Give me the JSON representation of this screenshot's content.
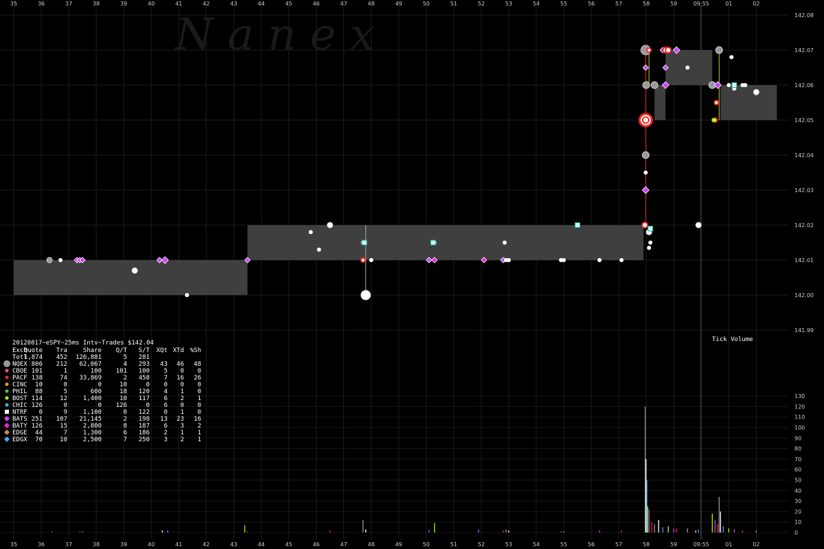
{
  "chart_data": [
    {
      "type": "scatter",
      "subtype": "price-trades",
      "watermark": "Nanex",
      "x_ticks": [
        "35",
        "36",
        "37",
        "38",
        "39",
        "40",
        "41",
        "42",
        "43",
        "44",
        "45",
        "46",
        "47",
        "48",
        "49",
        "50",
        "51",
        "52",
        "53",
        "54",
        "55",
        "56",
        "57",
        "58",
        "59",
        "09:55",
        "01",
        "02"
      ],
      "y_ticks": [
        "142.08",
        "142.07",
        "142.06",
        "142.05",
        "142.04",
        "142.03",
        "142.02",
        "142.01",
        "142.00",
        "141.99"
      ],
      "ylim": [
        141.99,
        142.08
      ],
      "xlim": [
        34.5,
        62.5
      ],
      "grid": true,
      "nbbo_bands": [
        {
          "x0": 35.0,
          "x1": 43.5,
          "bid": 142.0,
          "ask": 142.01
        },
        {
          "x0": 43.5,
          "x1": 57.9,
          "bid": 142.01,
          "ask": 142.02
        },
        {
          "x0": 58.3,
          "x1": 58.7,
          "bid": 142.05,
          "ask": 142.06
        },
        {
          "x0": 58.7,
          "x1": 60.4,
          "bid": 142.06,
          "ask": 142.07
        },
        {
          "x0": 60.7,
          "x1": 62.75,
          "bid": 142.05,
          "ask": 142.06
        }
      ],
      "trades": [
        {
          "x": 36.3,
          "y": 142.01,
          "exch": "NQEX",
          "size": 1
        },
        {
          "x": 36.7,
          "y": 142.01,
          "exch": "NTRF",
          "size": 1
        },
        {
          "x": 37.3,
          "y": 142.01,
          "exch": "BATS",
          "size": 1
        },
        {
          "x": 37.4,
          "y": 142.01,
          "exch": "BATS",
          "size": 1
        },
        {
          "x": 37.5,
          "y": 142.01,
          "exch": "BATS",
          "size": 1
        },
        {
          "x": 39.4,
          "y": 142.007,
          "exch": "NTRF",
          "size": 2
        },
        {
          "x": 40.3,
          "y": 142.01,
          "exch": "BATS",
          "size": 1
        },
        {
          "x": 40.5,
          "y": 142.01,
          "exch": "BATS",
          "size": 2
        },
        {
          "x": 41.3,
          "y": 142.0,
          "exch": "NTRF",
          "size": 1
        },
        {
          "x": 43.5,
          "y": 142.01,
          "exch": "BATS",
          "size": 1
        },
        {
          "x": 45.8,
          "y": 142.018,
          "exch": "NTRF",
          "size": 1
        },
        {
          "x": 46.1,
          "y": 142.013,
          "exch": "NTRF",
          "size": 1
        },
        {
          "x": 46.5,
          "y": 142.02,
          "exch": "NTRF",
          "size": 2
        },
        {
          "x": 47.7,
          "y": 142.015,
          "exch": "NTRF",
          "size": 1
        },
        {
          "x": 47.8,
          "y": 142.0,
          "exch": "NQEX",
          "size": 3
        },
        {
          "x": 47.7,
          "y": 142.01,
          "exch": "PACF",
          "size": 1
        },
        {
          "x": 48.0,
          "y": 142.01,
          "exch": "NTRF",
          "size": 1
        },
        {
          "x": 50.1,
          "y": 142.01,
          "exch": "BATS",
          "size": 1
        },
        {
          "x": 50.3,
          "y": 142.01,
          "exch": "BATY",
          "size": 1
        },
        {
          "x": 50.3,
          "y": 142.015,
          "exch": "NTRF",
          "size": 1
        },
        {
          "x": 52.1,
          "y": 142.01,
          "exch": "BATY",
          "size": 1
        },
        {
          "x": 52.8,
          "y": 142.01,
          "exch": "BATS",
          "size": 1
        },
        {
          "x": 52.9,
          "y": 142.01,
          "exch": "NTRF",
          "size": 1
        },
        {
          "x": 53.0,
          "y": 142.01,
          "exch": "NTRF",
          "size": 1
        },
        {
          "x": 52.85,
          "y": 142.015,
          "exch": "NTRF",
          "size": 1
        },
        {
          "x": 54.9,
          "y": 142.01,
          "exch": "NTRF",
          "size": 1
        },
        {
          "x": 55.0,
          "y": 142.01,
          "exch": "NTRF",
          "size": 1
        },
        {
          "x": 55.5,
          "y": 142.02,
          "exch": "NTRF",
          "size": 1
        },
        {
          "x": 56.3,
          "y": 142.01,
          "exch": "NTRF",
          "size": 1
        },
        {
          "x": 57.1,
          "y": 142.01,
          "exch": "NTRF",
          "size": 1
        },
        {
          "x": 57.95,
          "y": 142.02,
          "exch": "PACF",
          "size": 2
        },
        {
          "x": 58.1,
          "y": 142.018,
          "exch": "NTRF",
          "size": 2
        },
        {
          "x": 58.15,
          "y": 142.015,
          "exch": "NTRF",
          "size": 1
        },
        {
          "x": 58.1,
          "y": 142.0135,
          "exch": "NTRF",
          "size": 1
        },
        {
          "x": 57.98,
          "y": 142.03,
          "exch": "BATS",
          "size": 2
        },
        {
          "x": 57.98,
          "y": 142.035,
          "exch": "NTRF",
          "size": 1
        },
        {
          "x": 57.98,
          "y": 142.04,
          "exch": "NQEX",
          "size": 2
        },
        {
          "x": 57.98,
          "y": 142.05,
          "exch": "PACF",
          "size": 4
        },
        {
          "x": 57.98,
          "y": 142.06,
          "exch": "PACF",
          "size": 2
        },
        {
          "x": 58.0,
          "y": 142.06,
          "exch": "NQEX",
          "size": 2
        },
        {
          "x": 58.3,
          "y": 142.06,
          "exch": "NQEX",
          "size": 2
        },
        {
          "x": 57.98,
          "y": 142.065,
          "exch": "BATS",
          "size": 1
        },
        {
          "x": 57.98,
          "y": 142.07,
          "exch": "NQEX",
          "size": 3
        },
        {
          "x": 58.1,
          "y": 142.07,
          "exch": "PACF",
          "size": 1
        },
        {
          "x": 58.6,
          "y": 142.07,
          "exch": "BATS",
          "size": 1
        },
        {
          "x": 58.7,
          "y": 142.07,
          "exch": "PACF",
          "size": 2
        },
        {
          "x": 58.8,
          "y": 142.07,
          "exch": "PACF",
          "size": 2
        },
        {
          "x": 59.1,
          "y": 142.07,
          "exch": "BATS",
          "size": 2
        },
        {
          "x": 58.7,
          "y": 142.065,
          "exch": "BATS",
          "size": 1
        },
        {
          "x": 58.7,
          "y": 142.06,
          "exch": "BATS",
          "size": 2
        },
        {
          "x": 59.5,
          "y": 142.065,
          "exch": "NTRF",
          "size": 1
        },
        {
          "x": 60.4,
          "y": 142.06,
          "exch": "NQEX",
          "size": 2
        },
        {
          "x": 60.65,
          "y": 142.07,
          "exch": "NQEX",
          "size": 2
        },
        {
          "x": 60.6,
          "y": 142.06,
          "exch": "BATS",
          "size": 2
        },
        {
          "x": 60.55,
          "y": 142.055,
          "exch": "PACF",
          "size": 1
        },
        {
          "x": 60.5,
          "y": 142.05,
          "exch": "PACF",
          "size": 1
        },
        {
          "x": 60.45,
          "y": 142.05,
          "exch": "BOST",
          "size": 1
        },
        {
          "x": 61.1,
          "y": 142.068,
          "exch": "NTRF",
          "size": 1
        },
        {
          "x": 61.0,
          "y": 142.06,
          "exch": "NTRF",
          "size": 1
        },
        {
          "x": 61.5,
          "y": 142.06,
          "exch": "NTRF",
          "size": 1
        },
        {
          "x": 61.6,
          "y": 142.06,
          "exch": "NTRF",
          "size": 1
        },
        {
          "x": 61.2,
          "y": 142.059,
          "exch": "NTRF",
          "size": 1
        },
        {
          "x": 62.0,
          "y": 142.058,
          "exch": "NTRF",
          "size": 2
        },
        {
          "x": 59.9,
          "y": 142.02,
          "exch": "NTRF",
          "size": 2
        }
      ]
    },
    {
      "type": "bar",
      "subtype": "tick-volume",
      "title": "Tick Volume",
      "y_ticks": [
        "130",
        "120",
        "110",
        "100",
        "90",
        "80",
        "70",
        "60",
        "50",
        "40",
        "30",
        "20",
        "10",
        "0"
      ],
      "ylim": [
        0,
        130
      ],
      "x_ticks": [
        "35",
        "36",
        "37",
        "38",
        "39",
        "40",
        "41",
        "42",
        "43",
        "44",
        "45",
        "46",
        "47",
        "48",
        "49",
        "50",
        "51",
        "52",
        "53",
        "54",
        "55",
        "56",
        "57",
        "58",
        "59",
        "09:55",
        "01",
        "02"
      ],
      "bars": [
        {
          "x": 36.4,
          "v": 1
        },
        {
          "x": 37.4,
          "v": 1
        },
        {
          "x": 37.5,
          "v": 1
        },
        {
          "x": 40.4,
          "v": 2
        },
        {
          "x": 40.6,
          "v": 2
        },
        {
          "x": 43.4,
          "v": 7
        },
        {
          "x": 43.5,
          "v": 1
        },
        {
          "x": 46.5,
          "v": 2
        },
        {
          "x": 47.7,
          "v": 12
        },
        {
          "x": 47.8,
          "v": 3
        },
        {
          "x": 50.1,
          "v": 2
        },
        {
          "x": 50.3,
          "v": 9
        },
        {
          "x": 51.9,
          "v": 3
        },
        {
          "x": 52.8,
          "v": 2
        },
        {
          "x": 52.9,
          "v": 3
        },
        {
          "x": 53.0,
          "v": 2
        },
        {
          "x": 54.9,
          "v": 1
        },
        {
          "x": 55.0,
          "v": 1
        },
        {
          "x": 56.3,
          "v": 2
        },
        {
          "x": 57.1,
          "v": 2
        },
        {
          "x": 57.96,
          "v": 120
        },
        {
          "x": 57.99,
          "v": 70
        },
        {
          "x": 58.02,
          "v": 50
        },
        {
          "x": 58.05,
          "v": 25
        },
        {
          "x": 58.1,
          "v": 22
        },
        {
          "x": 58.2,
          "v": 10
        },
        {
          "x": 58.3,
          "v": 8
        },
        {
          "x": 58.45,
          "v": 12
        },
        {
          "x": 58.6,
          "v": 5
        },
        {
          "x": 58.8,
          "v": 6
        },
        {
          "x": 59.0,
          "v": 4
        },
        {
          "x": 59.1,
          "v": 4
        },
        {
          "x": 59.5,
          "v": 4
        },
        {
          "x": 59.8,
          "v": 2
        },
        {
          "x": 59.9,
          "v": 3
        },
        {
          "x": 60.4,
          "v": 18
        },
        {
          "x": 60.5,
          "v": 12
        },
        {
          "x": 60.6,
          "v": 8
        },
        {
          "x": 60.65,
          "v": 34
        },
        {
          "x": 60.7,
          "v": 20
        },
        {
          "x": 60.8,
          "v": 6
        },
        {
          "x": 61.0,
          "v": 4
        },
        {
          "x": 61.2,
          "v": 3
        },
        {
          "x": 61.5,
          "v": 2
        },
        {
          "x": 62.0,
          "v": 2
        }
      ]
    }
  ],
  "exchange_colors": {
    "NQEX": "#999999",
    "CBOE": "#ff44aa",
    "PACF": "#ff2222",
    "CINC": "#ff9900",
    "PHIL": "#44cc44",
    "BOST": "#aaff00",
    "CHIC": "#33bbdd",
    "NTRF": "#ffffff",
    "BATS": "#cc44ff",
    "BATY": "#ee22dd",
    "EDGE": "#cc8844",
    "EDGX": "#44aaff"
  },
  "stats_table": {
    "title": "20120817~eSPY~25ms Intv~Trades $142.04",
    "headers": [
      "Exch",
      "Quote",
      "Tra",
      "Share",
      "Q/T",
      "S/T",
      "XQt",
      "XTd",
      "%Sh"
    ],
    "total_row": [
      "Totl",
      "1,874",
      "452",
      "126,881",
      "5",
      "281",
      "",
      "",
      ""
    ],
    "rows": [
      {
        "exch": "NQEX",
        "icon": "circle",
        "cells": [
          "NQEX",
          "806",
          "212",
          "62,067",
          "4",
          "293",
          "43",
          "46",
          "48"
        ]
      },
      {
        "exch": "CBOE",
        "icon": "dot",
        "cells": [
          "CBOE",
          "101",
          "1",
          "100",
          "101",
          "100",
          "5",
          "0",
          "0"
        ]
      },
      {
        "exch": "PACF",
        "icon": "dot",
        "cells": [
          "PACF",
          "138",
          "74",
          "33,869",
          "2",
          "458",
          "7",
          "16",
          "26"
        ]
      },
      {
        "exch": "CINC",
        "icon": "dot",
        "cells": [
          "CINC",
          "10",
          "0",
          "0",
          "10",
          "0",
          "0",
          "0",
          "0"
        ]
      },
      {
        "exch": "PHIL",
        "icon": "dot",
        "cells": [
          "PHIL",
          "88",
          "5",
          "600",
          "18",
          "120",
          "4",
          "1",
          "0"
        ]
      },
      {
        "exch": "BOST",
        "icon": "dot",
        "cells": [
          "BOST",
          "114",
          "12",
          "1,400",
          "10",
          "117",
          "6",
          "2",
          "1"
        ]
      },
      {
        "exch": "CHIC",
        "icon": "dot",
        "cells": [
          "CHIC",
          "126",
          "0",
          "0",
          "126",
          "0",
          "6",
          "0",
          "0"
        ]
      },
      {
        "exch": "NTRF",
        "icon": "square",
        "cells": [
          "NTRF",
          "0",
          "9",
          "1,100",
          "0",
          "122",
          "0",
          "1",
          "0"
        ]
      },
      {
        "exch": "BATS",
        "icon": "diamond",
        "cells": [
          "BATS",
          "251",
          "107",
          "21,145",
          "2",
          "198",
          "13",
          "23",
          "16"
        ]
      },
      {
        "exch": "BATY",
        "icon": "diamond",
        "cells": [
          "BATY",
          "126",
          "15",
          "2,800",
          "8",
          "187",
          "6",
          "3",
          "2"
        ]
      },
      {
        "exch": "EDGE",
        "icon": "diamond",
        "cells": [
          "EDGE",
          "44",
          "7",
          "1,300",
          "6",
          "186",
          "2",
          "1",
          "1"
        ]
      },
      {
        "exch": "EDGX",
        "icon": "diamond",
        "cells": [
          "EDGX",
          "70",
          "10",
          "2,500",
          "7",
          "250",
          "3",
          "2",
          "1"
        ]
      }
    ]
  },
  "marker_line_label": "09:55"
}
